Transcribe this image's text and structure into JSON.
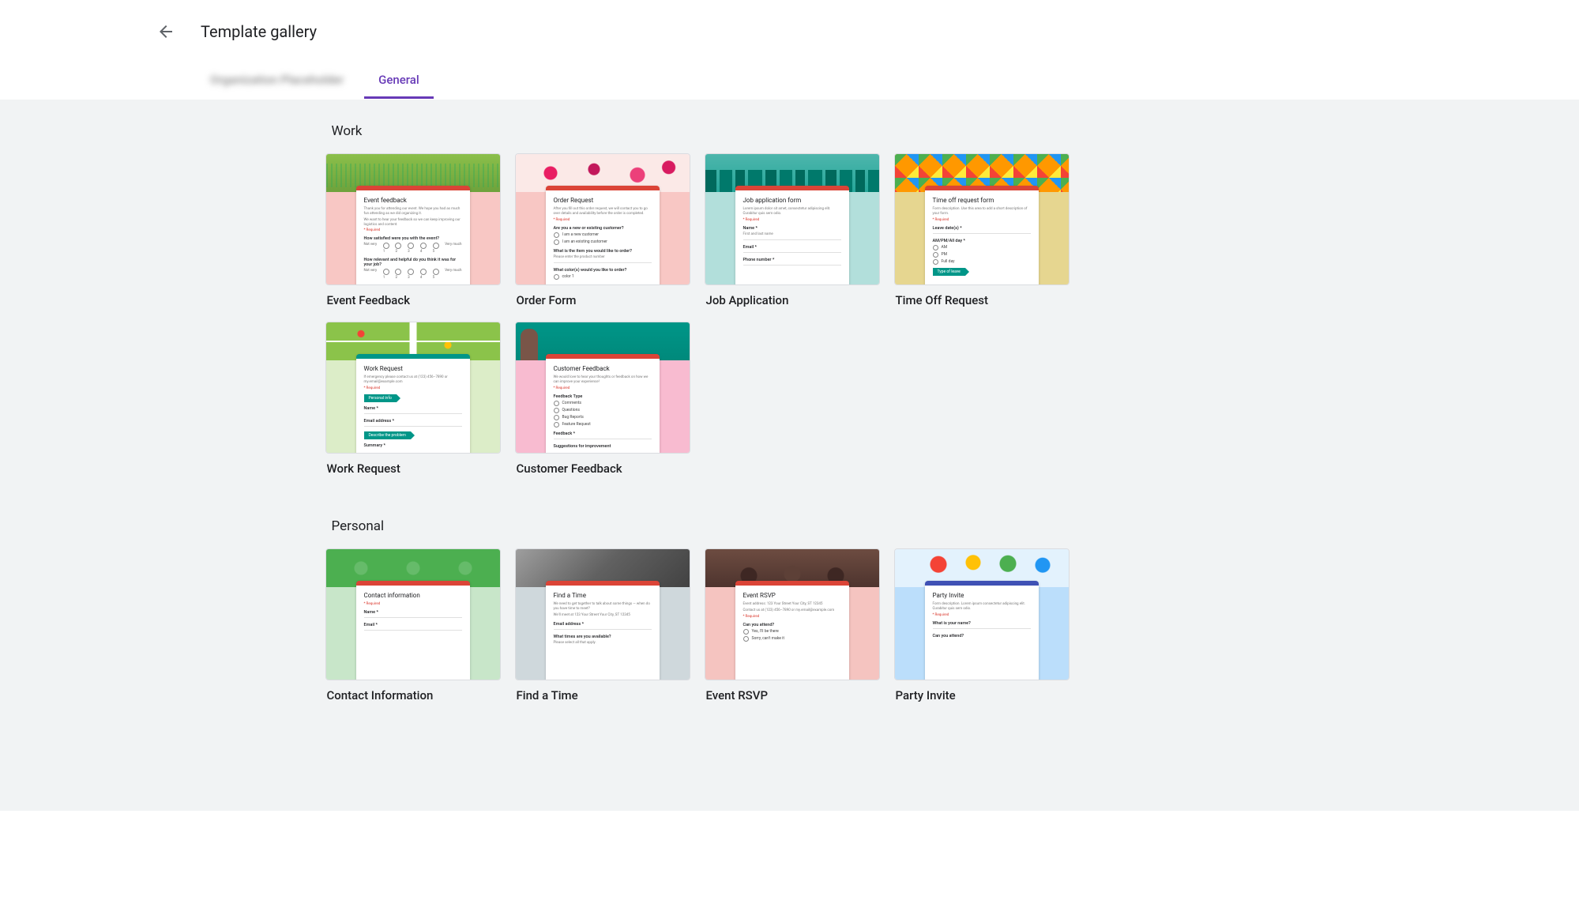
{
  "header": {
    "title": "Template gallery"
  },
  "tabs": {
    "org": "Organization Placeholder",
    "general": "General"
  },
  "sections": [
    {
      "title": "Work",
      "templates": [
        {
          "name": "Event Feedback",
          "bg": "#f8c7c4",
          "hdr": "img-grass",
          "accent": "red",
          "heading": "Event feedback",
          "desc": "Thank you for attending our event. We hope you had as much fun attending as we did organizing it.",
          "lines": [
            {
              "type": "desc",
              "text": "We want to hear your feedback so we can keep improving our logistics and content."
            },
            {
              "type": "req"
            },
            {
              "type": "q",
              "text": "How satisfied were you with the event?"
            },
            {
              "type": "scale",
              "left": "Not very",
              "right": "Very much",
              "points": [
                "1",
                "2",
                "3",
                "4",
                "5"
              ]
            },
            {
              "type": "q",
              "text": "How relevant and helpful do you think it was for your job?"
            },
            {
              "type": "scale",
              "left": "Not very",
              "right": "Very much",
              "points": [
                "1",
                "2",
                "3",
                "4",
                "5"
              ]
            }
          ]
        },
        {
          "name": "Order Form",
          "bg": "#f8c7c4",
          "hdr": "img-flowers",
          "accent": "red",
          "heading": "Order Request",
          "desc": "After you fill out this order request, we will contact you to go over details and availability before the order is completed.",
          "lines": [
            {
              "type": "req"
            },
            {
              "type": "q",
              "text": "Are you a new or existing customer?"
            },
            {
              "type": "radio",
              "text": "I am a new customer"
            },
            {
              "type": "radio",
              "text": "I am an existing customer"
            },
            {
              "type": "q",
              "text": "What is the item you would like to order?"
            },
            {
              "type": "desc",
              "text": "Please enter the product number"
            },
            {
              "type": "line"
            },
            {
              "type": "q",
              "text": "What color(s) would you like to order?"
            },
            {
              "type": "radio",
              "text": "color 1"
            }
          ]
        },
        {
          "name": "Job Application",
          "bg": "#b2dfdb",
          "hdr": "img-skyline",
          "accent": "red",
          "heading": "Job application form",
          "desc": "Lorem ipsum dolor sit amet, consectetur adipiscing elit. Curabitur quis sem odio.",
          "lines": [
            {
              "type": "req"
            },
            {
              "type": "q",
              "text": "Name *"
            },
            {
              "type": "desc",
              "text": "First and last name"
            },
            {
              "type": "line"
            },
            {
              "type": "q",
              "text": "Email *"
            },
            {
              "type": "line"
            },
            {
              "type": "q",
              "text": "Phone number *"
            },
            {
              "type": "line"
            }
          ]
        },
        {
          "name": "Time Off Request",
          "bg": "#e6d690",
          "hdr": "img-triangles",
          "accent": "red",
          "heading": "Time off request form",
          "desc": "Form description. Use this area to add a short description of your form.",
          "lines": [
            {
              "type": "req"
            },
            {
              "type": "q",
              "text": "Leave date(s) *"
            },
            {
              "type": "line"
            },
            {
              "type": "q",
              "text": "AM/PM/All day *"
            },
            {
              "type": "radio",
              "text": "AM"
            },
            {
              "type": "radio",
              "text": "PM"
            },
            {
              "type": "radio",
              "text": "Full day"
            },
            {
              "type": "chip",
              "text": "Type of leave"
            }
          ]
        },
        {
          "name": "Work Request",
          "bg": "#dcedc8",
          "hdr": "img-map",
          "accent": "teal",
          "heading": "Work Request",
          "desc": "If emergency please contact us at (123) 456–7890 or my.email@example.com",
          "lines": [
            {
              "type": "req"
            },
            {
              "type": "chip",
              "text": "Personal info"
            },
            {
              "type": "q",
              "text": "Name *"
            },
            {
              "type": "line"
            },
            {
              "type": "q",
              "text": "Email address *"
            },
            {
              "type": "line"
            },
            {
              "type": "chip",
              "text": "Describe the problem"
            },
            {
              "type": "q",
              "text": "Summary *"
            }
          ]
        },
        {
          "name": "Customer Feedback",
          "bg": "#f8bbd0",
          "hdr": "img-portrait",
          "accent": "red",
          "heading": "Customer Feedback",
          "desc": "We would love to hear your thoughts or feedback on how we can improve your experience!",
          "lines": [
            {
              "type": "req"
            },
            {
              "type": "q",
              "text": "Feedback Type"
            },
            {
              "type": "radio",
              "text": "Comments"
            },
            {
              "type": "radio",
              "text": "Questions"
            },
            {
              "type": "radio",
              "text": "Bug Reports"
            },
            {
              "type": "radio",
              "text": "Feature Request"
            },
            {
              "type": "q",
              "text": "Feedback *"
            },
            {
              "type": "line"
            },
            {
              "type": "q",
              "text": "Suggestions for improvement"
            }
          ]
        }
      ]
    },
    {
      "title": "Personal",
      "templates": [
        {
          "name": "Contact Information",
          "bg": "#c8e6c9",
          "hdr": "img-icons",
          "accent": "red",
          "heading": "Contact information",
          "desc": "",
          "lines": [
            {
              "type": "req"
            },
            {
              "type": "q",
              "text": "Name *"
            },
            {
              "type": "line"
            },
            {
              "type": "q",
              "text": "Email *"
            },
            {
              "type": "line"
            }
          ]
        },
        {
          "name": "Find a Time",
          "bg": "#cfd8dc",
          "hdr": "img-room",
          "accent": "red",
          "heading": "Find a Time",
          "desc": "We need to get together to talk about some things — when do you have time to meet?",
          "lines": [
            {
              "type": "desc",
              "text": "We'll meet at 123 Your Street Your City, ST 12345"
            },
            {
              "type": "q",
              "text": "Email address *"
            },
            {
              "type": "line"
            },
            {
              "type": "q",
              "text": "What times are you available?"
            },
            {
              "type": "desc",
              "text": "Please select all that apply."
            }
          ]
        },
        {
          "name": "Event RSVP",
          "bg": "#f5c4c0",
          "hdr": "img-crowd",
          "accent": "red",
          "heading": "Event RSVP",
          "desc": "Event address: 123 Your Street Your City, ST 12345",
          "lines": [
            {
              "type": "desc",
              "text": "Contact us at (123) 456–7890 or my.email@example.com"
            },
            {
              "type": "req"
            },
            {
              "type": "q",
              "text": "Can you attend?"
            },
            {
              "type": "radio",
              "text": "Yes, I'll be there"
            },
            {
              "type": "radio",
              "text": "Sorry, can't make it"
            }
          ]
        },
        {
          "name": "Party Invite",
          "bg": "#bbdefb",
          "hdr": "img-balloons",
          "accent": "blue",
          "heading": "Party Invite",
          "desc": "Form description. Lorem ipsum consectetur adipiscing elit. Curabitur quis sem odio.",
          "lines": [
            {
              "type": "req"
            },
            {
              "type": "q",
              "text": "What is your name?"
            },
            {
              "type": "line"
            },
            {
              "type": "q",
              "text": "Can you attend?"
            }
          ]
        }
      ]
    }
  ]
}
